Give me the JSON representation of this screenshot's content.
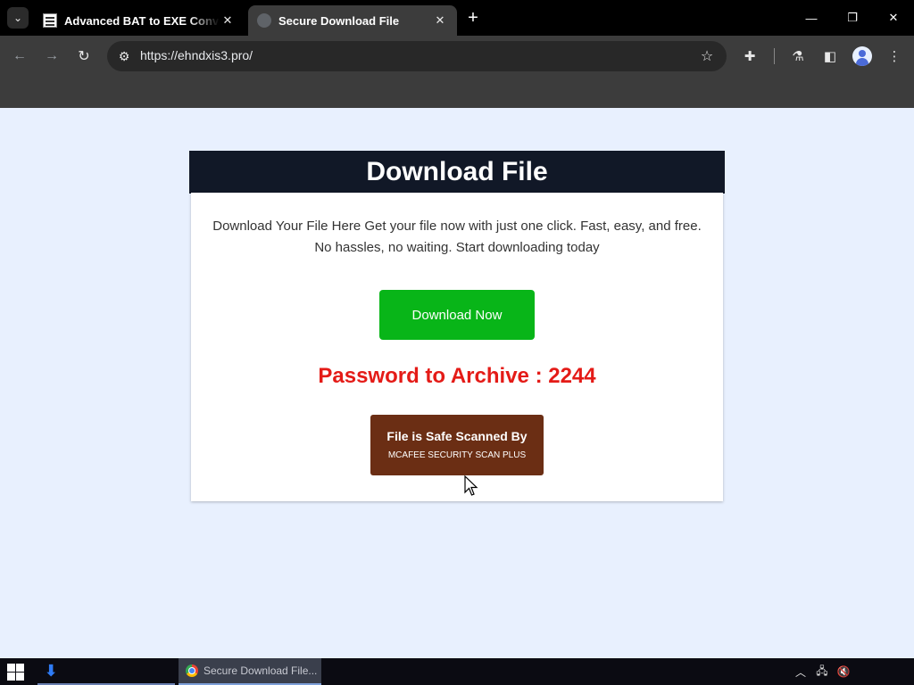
{
  "browser": {
    "tabs": [
      {
        "title": "Advanced BAT to EXE Converter",
        "active": false
      },
      {
        "title": "Secure Download File",
        "active": true
      }
    ],
    "url": "https://ehndxis3.pro/",
    "icons": {
      "tab_search": "chevron-down-icon",
      "close": "close-icon",
      "new_tab": "plus-icon",
      "back": "arrow-left-icon",
      "forward": "arrow-right-icon",
      "reload": "reload-icon",
      "site_info": "tune-icon",
      "bookmark": "star-icon",
      "extensions": "puzzle-icon",
      "labs": "flask-icon",
      "side_panel": "side-panel-icon",
      "profile": "profile-icon",
      "menu": "kebab-menu-icon"
    }
  },
  "page": {
    "header_title": "Download File",
    "description": "Download Your File Here Get your file now with just one click. Fast, easy, and free. No hassles, no waiting. Start downloading today",
    "download_button": "Download Now",
    "password_text": "Password to Archive : 2244",
    "scan_badge": {
      "title": "File is Safe Scanned By",
      "subtitle": "MCAFEE SECURITY SCAN PLUS"
    },
    "colors": {
      "page_background": "#e8f0fe",
      "header_background": "#111827",
      "download_button": "#08b518",
      "password_text": "#e41b17",
      "scan_badge": "#6b2e14"
    }
  },
  "taskbar": {
    "app_label": "Secure Download File...",
    "icons": [
      "windows-start-icon",
      "download-icon",
      "chrome-icon",
      "chevron-up-icon",
      "network-icon",
      "volume-muted-icon"
    ]
  }
}
